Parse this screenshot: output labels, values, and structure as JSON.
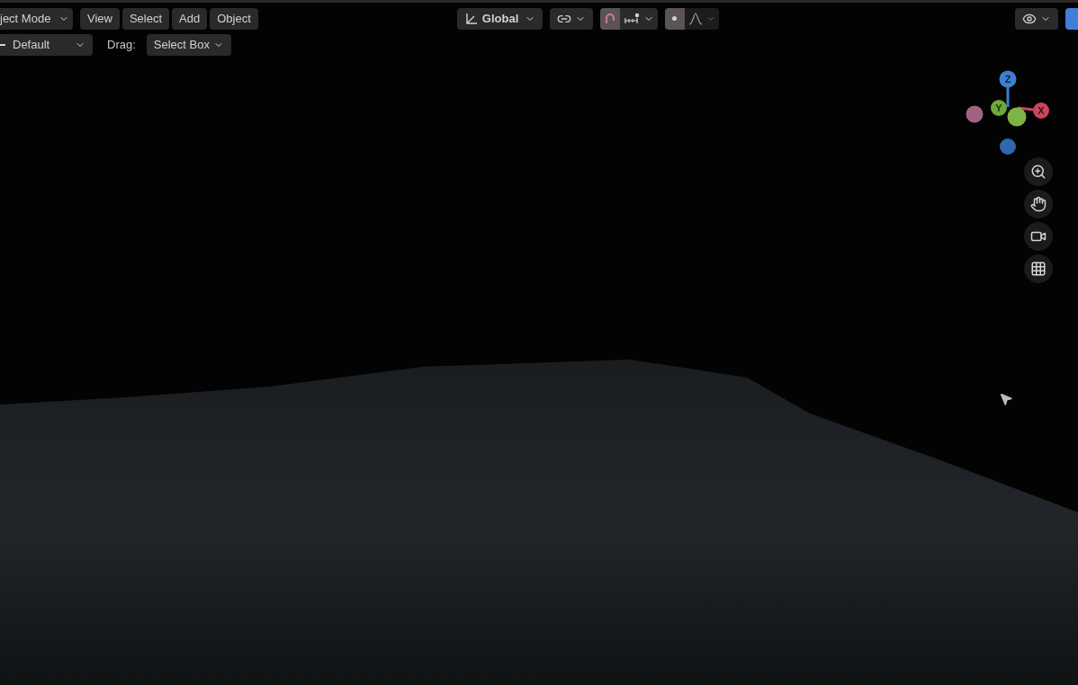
{
  "header": {
    "mode": "ject Mode",
    "menus": [
      "View",
      "Select",
      "Add",
      "Object"
    ],
    "orientation": "Global",
    "snap": {
      "on": true
    },
    "proportional": {
      "on": true
    }
  },
  "tool_settings": {
    "orientation": "Default",
    "drag_label": "Drag:",
    "drag_mode": "Select Box"
  },
  "gizmo": {
    "axes": [
      {
        "label": "Z",
        "color": "#3d7fd0"
      },
      {
        "label": "Y",
        "color": "#6fa83a"
      },
      {
        "label": "X",
        "color": "#c9475f"
      }
    ]
  }
}
